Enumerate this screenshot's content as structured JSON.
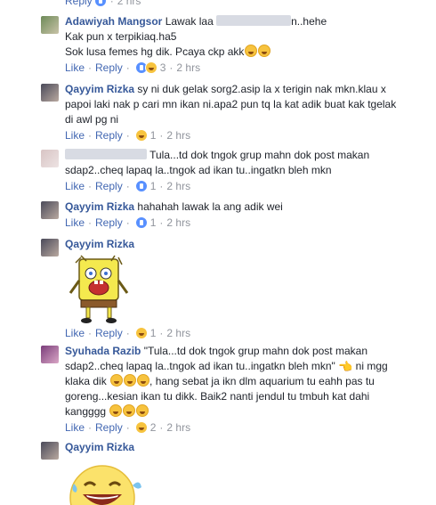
{
  "top": {
    "reply": "Reply",
    "time": "2 hrs"
  },
  "comments": [
    {
      "name": "Adawiyah Mangsor",
      "line1_a": "Lawak laa",
      "line1_b": "n..hehe",
      "line2": "Kak pun x terpikiaq.ha5",
      "line3": "Sok lusa femes hg dik. Pcaya ckp akk",
      "like": "Like",
      "reply": "Reply",
      "count": "3",
      "time": "2 hrs"
    },
    {
      "name": "Qayyim Rizka",
      "line1": "sy ni duk gelak sorg2.asip la x terigin nak mkn.klau x",
      "line2": "papoi laki nak p cari mn ikan ni.apa2 pun tq la kat adik buat kak tgelak",
      "line3": "di awl pg ni",
      "like": "Like",
      "reply": "Reply",
      "count": "1",
      "time": "2 hrs"
    },
    {
      "name": "",
      "line1": "Tula...td dok tngok grup mahn dok post makan",
      "line2": "sdap2..cheq lapaq la..tngok ad ikan tu..ingatkn bleh mkn",
      "like": "Like",
      "reply": "Reply",
      "count": "1",
      "time": "2 hrs"
    },
    {
      "name": "Qayyim Rizka",
      "text": "hahahah lawak la ang adik wei",
      "like": "Like",
      "reply": "Reply",
      "count": "1",
      "time": "2 hrs"
    },
    {
      "name": "Qayyim Rizka",
      "like": "Like",
      "reply": "Reply",
      "count": "1",
      "time": "2 hrs"
    },
    {
      "name": "Syuhada Razib",
      "line1": "\"Tula...td dok tngok grup mahn dok post makan",
      "line2": "sdap2..cheq lapaq la..tngok ad ikan tu..ingatkn bleh mkn\"",
      "line2_b": "ni mgg",
      "line3_a": "klaka dik",
      "line3_b": ", hang sebat ja ikn dlm aquarium tu eahh pas tu",
      "line4": "goreng...kesian ikan tu dikk. Baik2 nanti jendul tu tmbuh kat dahi",
      "line5": "kangggg",
      "like": "Like",
      "reply": "Reply",
      "count": "2",
      "time": "2 hrs"
    },
    {
      "name": "Qayyim Rizka"
    }
  ]
}
